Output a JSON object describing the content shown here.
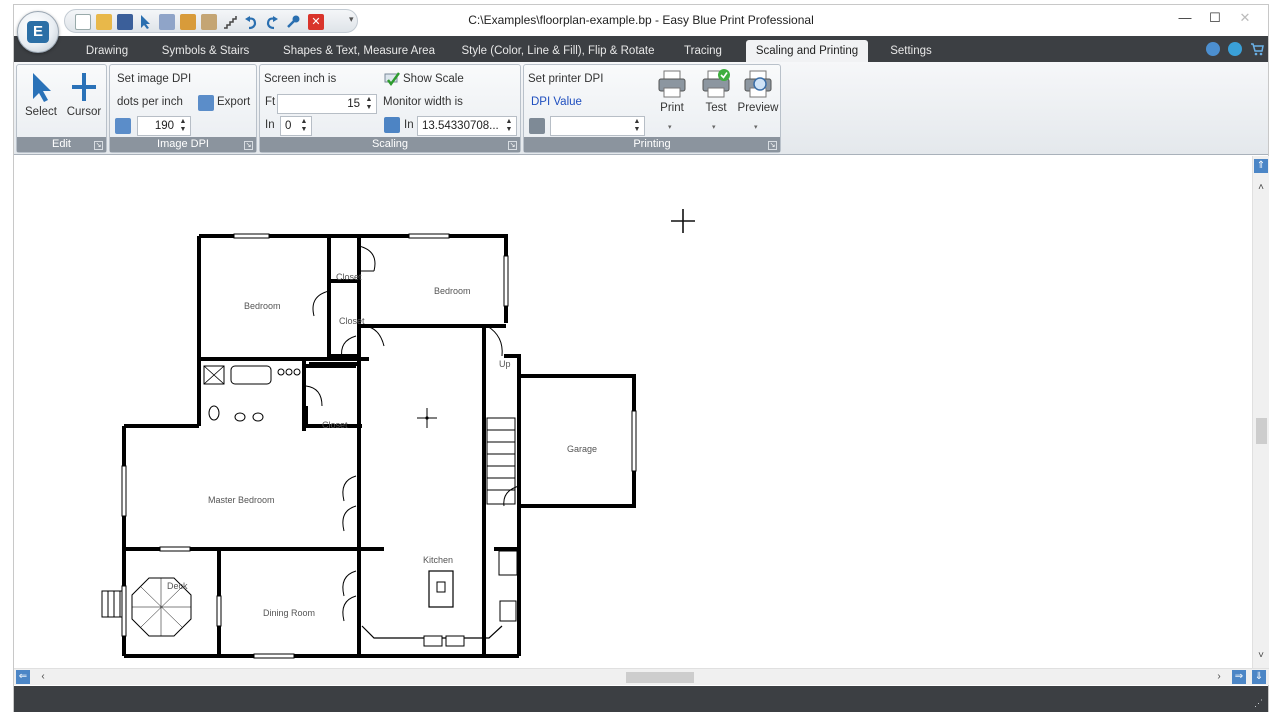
{
  "window": {
    "title": "C:\\Examples\\floorplan-example.bp - Easy Blue Print Professional",
    "minimize": "—",
    "maximize": "☐",
    "close": "✕"
  },
  "tabs": [
    {
      "label": "Drawing"
    },
    {
      "label": "Symbols & Stairs"
    },
    {
      "label": "Shapes & Text, Measure Area"
    },
    {
      "label": "Style (Color, Line & Fill), Flip & Rotate"
    },
    {
      "label": "Tracing"
    },
    {
      "label": "Scaling and Printing"
    },
    {
      "label": "Settings"
    }
  ],
  "ribbon": {
    "edit": {
      "select_label": "Select",
      "cursor_label": "Cursor",
      "group_label": "Edit"
    },
    "image_dpi": {
      "set_label": "Set image DPI",
      "dots_label": "dots per inch",
      "export_label": "Export",
      "dpi_value": "190",
      "group_label": "Image DPI"
    },
    "scaling": {
      "screen_inch_label": "Screen inch is",
      "show_scale_label": "Show Scale",
      "ft_label": "Ft",
      "ft_value": "15",
      "monitor_width_label": "Monitor width is",
      "in_label": "In",
      "in_value": "0",
      "monitor_in_label": "In",
      "monitor_value": "13.54330708...",
      "group_label": "Scaling"
    },
    "printing": {
      "set_printer_label": "Set printer DPI",
      "dpi_value_label": "DPI Value",
      "dpi_value": "",
      "print_label": "Print",
      "test_label": "Test",
      "preview_label": "Preview",
      "group_label": "Printing"
    }
  },
  "floorplan": {
    "rooms": {
      "bedroom_1": "Bedroom",
      "bedroom_2": "Bedroom",
      "closet_1": "Closet",
      "closet_2": "Closet",
      "closet_3": "Closet",
      "up": "Up",
      "garage": "Garage",
      "master_bedroom": "Master Bedroom",
      "kitchen": "Kitchen",
      "deck": "Deck",
      "dining_room": "Dining Room"
    }
  },
  "colors": {
    "dark_bar": "#3c3f43",
    "accent_blue": "#2b6fa6",
    "active_tab": "#f1f2f4"
  }
}
